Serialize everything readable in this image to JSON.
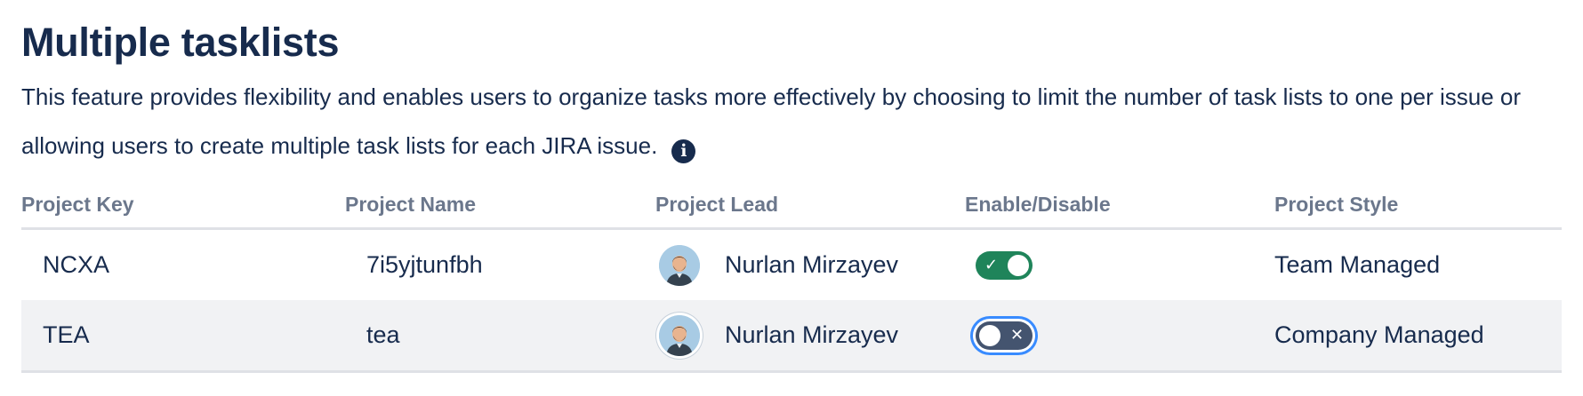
{
  "heading": "Multiple tasklists",
  "description": "This feature provides flexibility and enables users to organize tasks more effectively by choosing to limit the number of task lists to one per issue or allowing users to create multiple task lists for each JIRA issue.",
  "info_icon": "info-icon",
  "columns": {
    "key": "Project Key",
    "name": "Project Name",
    "lead": "Project Lead",
    "toggle": "Enable/Disable",
    "style": "Project Style"
  },
  "rows": [
    {
      "key": "NCXA",
      "name": "7i5yjtunfbh",
      "lead": "Nurlan Mirzayev",
      "enabled": true,
      "toggle_glyph": "✓",
      "style": "Team Managed"
    },
    {
      "key": "TEA",
      "name": "tea",
      "lead": "Nurlan Mirzayev",
      "enabled": false,
      "toggle_glyph": "✕",
      "style": "Company Managed"
    }
  ],
  "colors": {
    "text": "#172b4d",
    "header_text": "#6b778c",
    "toggle_on": "#1f845a",
    "toggle_off": "#44546f",
    "focus_ring": "#388bff",
    "row_alt_bg": "#f1f2f4"
  }
}
